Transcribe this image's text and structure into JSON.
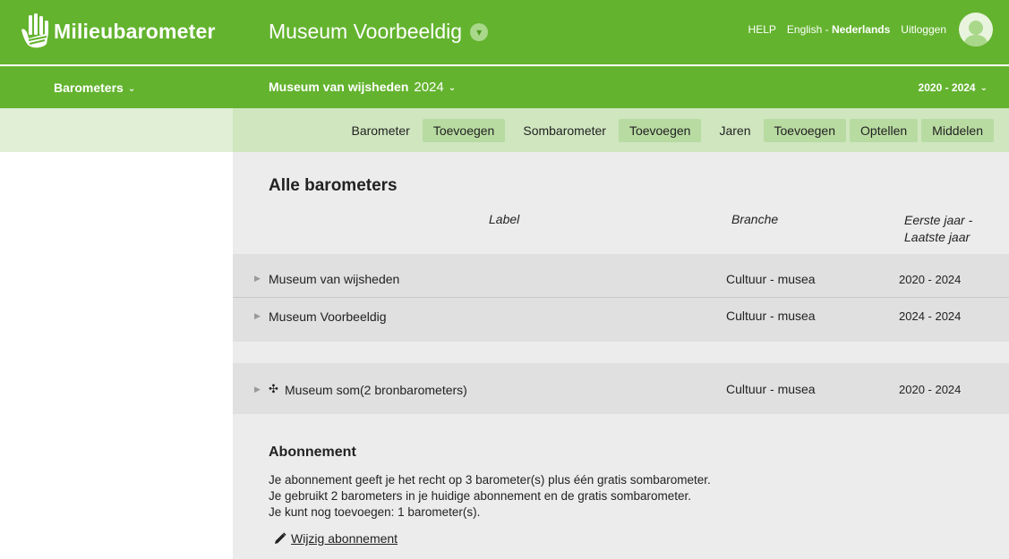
{
  "header": {
    "app_name": "Milieubarometer",
    "org_title": "Museum Voorbeeldig",
    "links": {
      "help": "HELP",
      "lang_en": "English",
      "lang_sep": " - ",
      "lang_nl": "Nederlands",
      "logout": "Uitloggen"
    }
  },
  "subnav": {
    "barometers_label": "Barometers",
    "museum": "Museum van wijsheden",
    "year": "2024",
    "range": "2020 - 2024"
  },
  "toolbar": {
    "barometer_label": "Barometer",
    "barometer_add": "Toevoegen",
    "sombarometer_label": "Sombarometer",
    "sombarometer_add": "Toevoegen",
    "jaren_label": "Jaren",
    "jaren_add": "Toevoegen",
    "optellen": "Optellen",
    "middelen": "Middelen"
  },
  "main": {
    "title": "Alle barometers",
    "columns": {
      "label": "Label",
      "branche": "Branche",
      "years_line1": "Eerste jaar -",
      "years_line2": "Laatste jaar"
    },
    "rows": [
      {
        "name": "Museum van wijsheden",
        "branche": "Cultuur - musea",
        "years": "2020 - 2024"
      },
      {
        "name": "Museum Voorbeeldig",
        "branche": "Cultuur - musea",
        "years": "2024 - 2024"
      }
    ],
    "sum_row": {
      "icon": "✣",
      "name": "Museum som(2 bronbarometers)",
      "branche": "Cultuur - musea",
      "years": "2020 - 2024"
    }
  },
  "subscription": {
    "title": "Abonnement",
    "line1": "Je abonnement geeft je het recht op 3 barometer(s) plus één gratis sombarometer.",
    "line2": "Je gebruikt 2 barometers in je huidige abonnement en de gratis sombarometer.",
    "line3": "Je kunt nog toevoegen: 1 barometer(s).",
    "edit_link": "Wijzig abonnement"
  },
  "colors": {
    "brand_green": "#63b32e",
    "toolbar_green": "#cfe6bf",
    "button_green": "#b8dba1"
  }
}
